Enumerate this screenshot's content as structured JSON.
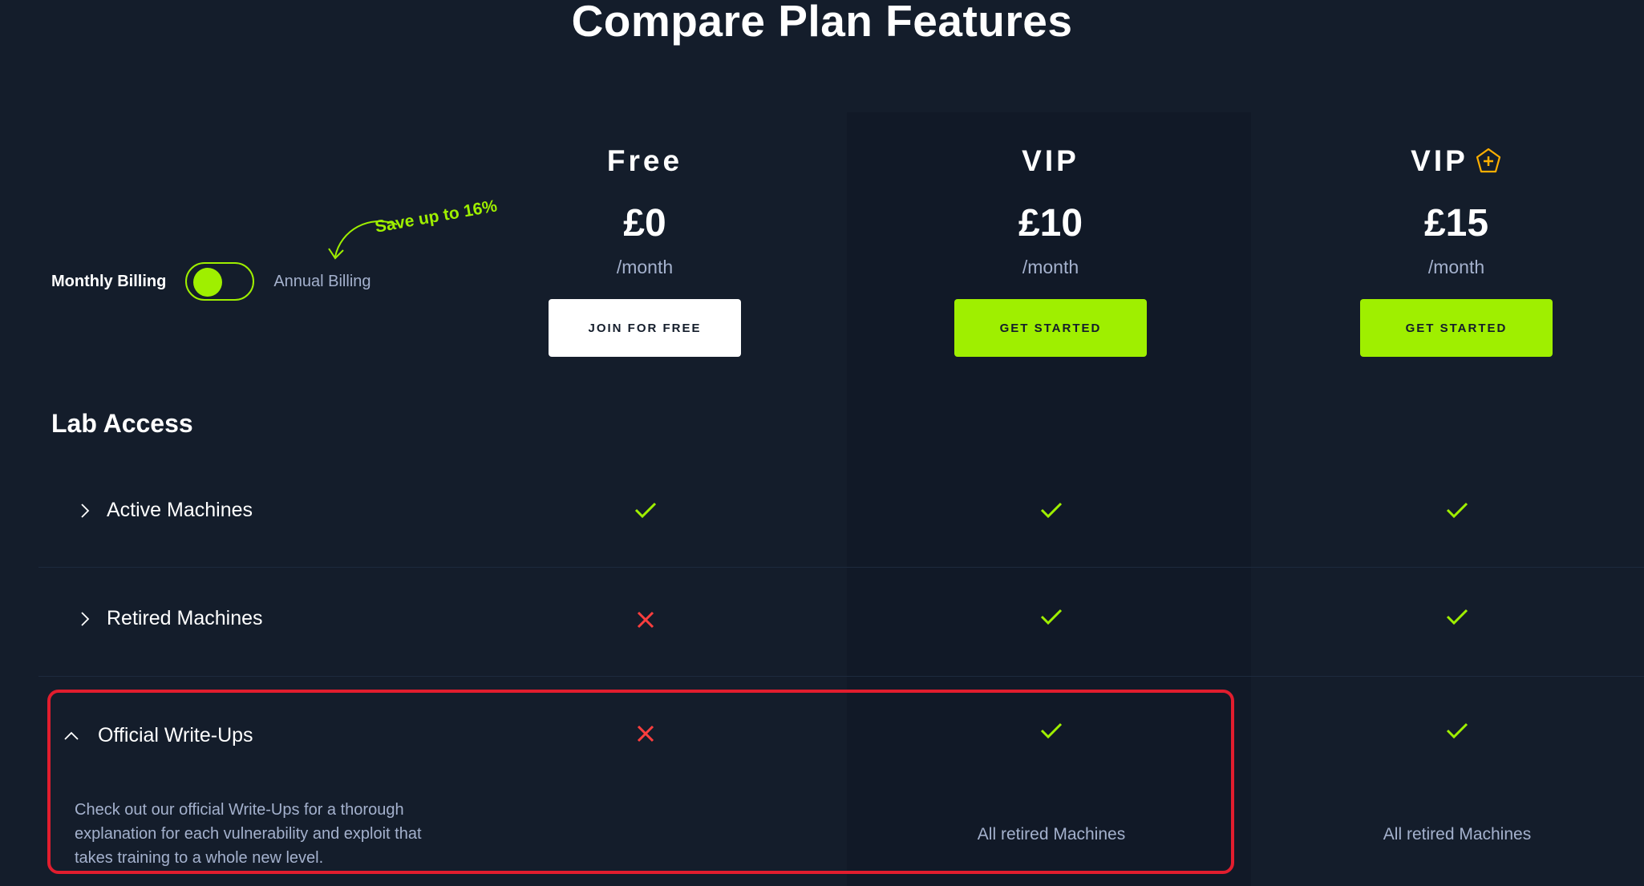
{
  "header": {
    "title": "Compare Plan Features"
  },
  "billing": {
    "monthly_label": "Monthly Billing",
    "annual_label": "Annual Billing",
    "save_note": "Save up to 16%",
    "toggle_state": "monthly"
  },
  "plans": [
    {
      "name": "Free",
      "price": "£0",
      "period": "/month",
      "button": "JOIN FOR FREE"
    },
    {
      "name": "VIP",
      "price": "£10",
      "period": "/month",
      "button": "GET STARTED"
    },
    {
      "name": "VIP",
      "price": "£15",
      "period": "/month",
      "button": "GET STARTED",
      "icon": "plus-badge-icon"
    }
  ],
  "section": {
    "title": "Lab Access"
  },
  "features": [
    {
      "label": "Active Machines",
      "values": [
        "check",
        "check",
        "check"
      ]
    },
    {
      "label": "Retired Machines",
      "values": [
        "cross",
        "check",
        "check"
      ]
    },
    {
      "label": "Official Write-Ups",
      "values": [
        "cross",
        "check",
        "check"
      ],
      "expanded": true,
      "description": "Check out our official Write-Ups for a thorough explanation for each vulnerability and exploit that takes training to a whole new level.",
      "notes": [
        "",
        "All retired Machines",
        "All retired Machines"
      ]
    }
  ],
  "colors": {
    "accent": "#9fef00",
    "background": "#141d2b",
    "cross": "#ff3e3e",
    "highlight": "#e11d2e",
    "badge": "#ffaf00"
  }
}
